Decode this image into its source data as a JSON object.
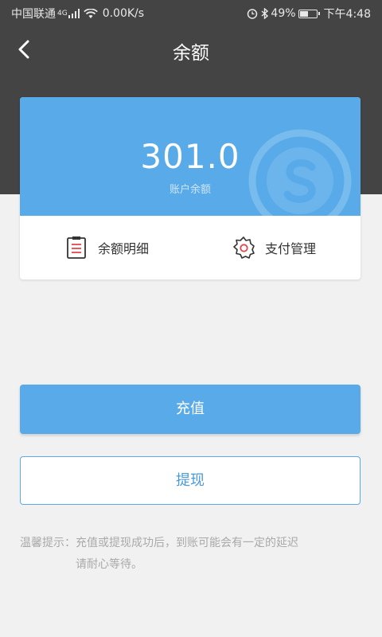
{
  "status_bar": {
    "carrier": "中国联通",
    "network_type": "4G",
    "speed": "0.00K/s",
    "battery_percent": "49%",
    "battery_level": 0.49,
    "time": "下午4:48",
    "icons": [
      "signal-icon",
      "wifi-icon",
      "alarm-icon",
      "bluetooth-icon",
      "battery-icon"
    ]
  },
  "nav": {
    "title": "余额",
    "back_icon": "chevron-left-icon"
  },
  "balance": {
    "amount": "301.0",
    "label": "账户余额"
  },
  "actions": [
    {
      "label": "余额明细",
      "icon": "clipboard-list-icon"
    },
    {
      "label": "支付管理",
      "icon": "gear-icon"
    }
  ],
  "buttons": {
    "recharge": "充值",
    "withdraw": "提现"
  },
  "tip": {
    "line1": "温馨提示：充值或提现成功后，到账可能会有一定的延迟",
    "line2": "请耐心等待。"
  },
  "colors": {
    "header_bg": "#444444",
    "accent": "#59aae8",
    "page_bg": "#f1f1f1",
    "icon_red": "#e0454b"
  }
}
